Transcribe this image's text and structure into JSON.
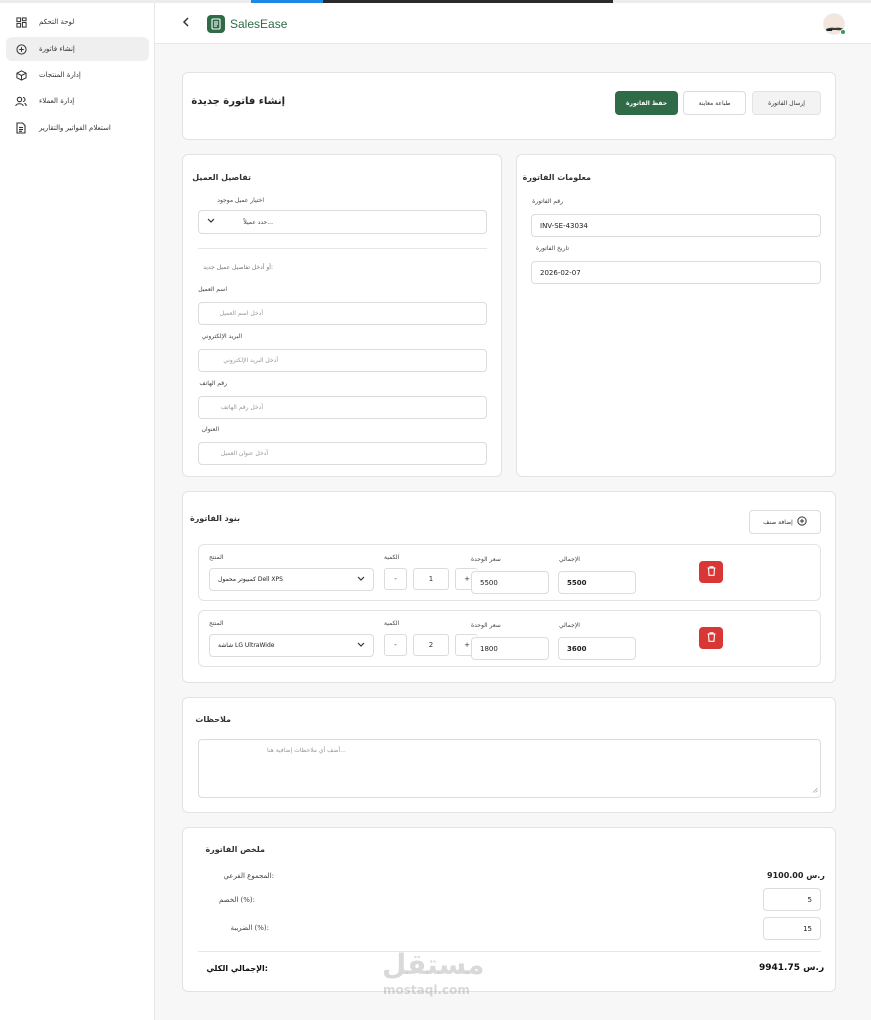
{
  "sidebar": {
    "items": [
      {
        "label": "لوحة التحكم",
        "icon": "dashboard-icon"
      },
      {
        "label": "إنشاء فاتورة",
        "icon": "plus-circle-icon"
      },
      {
        "label": "إدارة المنتجات",
        "icon": "box-icon"
      },
      {
        "label": "إدارة العملاء",
        "icon": "users-icon"
      },
      {
        "label": "استعلام الفواتير والتقارير",
        "icon": "document-icon"
      }
    ]
  },
  "header": {
    "brand": "SalesEase"
  },
  "page": {
    "title": "إنشاء فاتورة جديدة",
    "save_label": "حفظ الفاتورة",
    "preview_label": "طباعة معاينة",
    "send_label": "إرسال الفاتورة"
  },
  "client": {
    "title": "تفاصيل العميل",
    "select_label": "اختيار عميل موجود",
    "select_value": "حدد عميلاً...",
    "or_text": "أو أدخل تفاصيل عميل جديد:",
    "name_label": "اسم العميل",
    "name_placeholder": "أدخل اسم العميل",
    "email_label": "البريد الإلكتروني",
    "email_placeholder": "أدخل البريد الإلكتروني",
    "phone_label": "رقم الهاتف",
    "phone_placeholder": "أدخل رقم الهاتف",
    "address_label": "العنوان",
    "address_placeholder": "أدخل عنوان العميل"
  },
  "invoice_info": {
    "title": "معلومات الفاتورة",
    "number_label": "رقم الفاتورة",
    "number_value": "INV-SE-43034",
    "date_label": "تاريخ الفاتورة",
    "date_value": "2026-02-07"
  },
  "items": {
    "title": "بنود الفاتورة",
    "add_label": "إضافة صنف",
    "product_label": "المنتج",
    "qty_label": "الكمية",
    "price_label": "سعر الوحدة",
    "total_label": "الإجمالي",
    "minus": "-",
    "plus": "+",
    "rows": [
      {
        "product": "كمبيوتر محمول Dell XPS",
        "qty": "1",
        "price": "5500",
        "total": "5500"
      },
      {
        "product": "شاشة LG UltraWide",
        "qty": "2",
        "price": "1800",
        "total": "3600"
      }
    ]
  },
  "notes": {
    "title": "ملاحظات",
    "placeholder": "أضف أي ملاحظات إضافية هنا..."
  },
  "summary": {
    "title": "ملخص الفاتورة",
    "subtotal_label": "المجموع الفرعي:",
    "subtotal_value": "ر.س 9100.00",
    "discount_label": "الخصم (%):",
    "discount_value": "5",
    "tax_label": "الضريبة (%):",
    "tax_value": "15",
    "grand_label": "الإجمالي الكلي:",
    "grand_value": "ر.س 9941.75"
  },
  "watermark": {
    "arabic": "مستقل",
    "latin": "mostaql.com"
  },
  "colors": {
    "primary": "#2f6b47",
    "danger": "#d93636"
  }
}
